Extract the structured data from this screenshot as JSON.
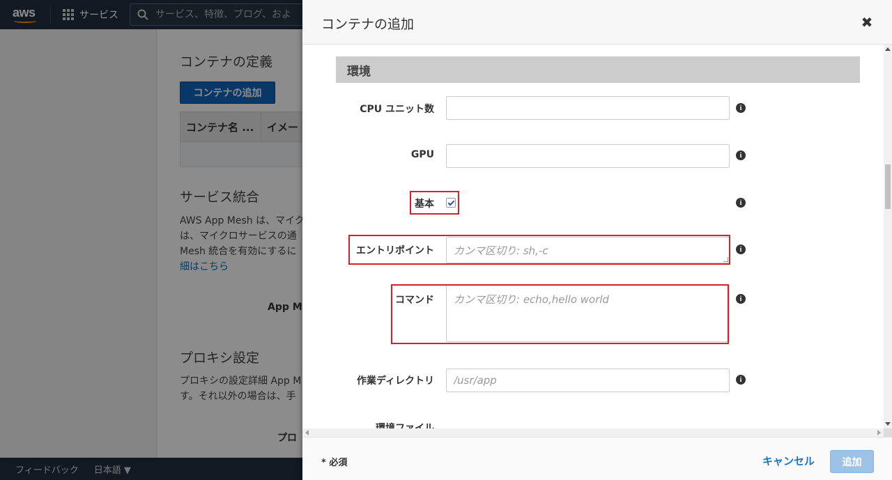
{
  "topnav": {
    "logo_text": "aws",
    "services_label": "サービス",
    "search_placeholder": "サービス、特徴、ブログ、およ"
  },
  "background": {
    "container_def_heading": "コンテナの定義",
    "add_container_button": "コンテナの追加",
    "table_headers": [
      "コンテナ名 ...",
      "イメー"
    ],
    "service_integration_heading": "サービス統合",
    "service_integration_lines": [
      "AWS App Mesh は、マイク",
      "は、マイクロサービスの通",
      "Mesh 統合を有効にするに"
    ],
    "service_integration_link": "細はこちら",
    "app_mesh_label": "App Me",
    "proxy_heading": "プロキシ設定",
    "proxy_lines": [
      "プロキシの設定詳細 App M",
      "す。それ以外の場合は、手"
    ],
    "proxy_bold": "プロ"
  },
  "footer": {
    "feedback": "フィードバック",
    "language": "日本語 ▼"
  },
  "modal": {
    "title": "コンテナの追加",
    "close_glyph": "✖",
    "section_heading": "環境",
    "fields": {
      "cpu_label": "CPU ユニット数",
      "cpu_value": "",
      "gpu_label": "GPU",
      "gpu_value": "",
      "essential_label": "基本",
      "essential_checked": true,
      "entrypoint_label": "エントリポイント",
      "entrypoint_placeholder": "カンマ区切り: sh,-c",
      "command_label": "コマンド",
      "command_placeholder": "カンマ区切り: echo,hello world",
      "workdir_label": "作業ディレクトリ",
      "workdir_placeholder": "/usr/app",
      "envfile_label": "環境ファイル"
    },
    "info_glyph": "i",
    "required_note": "* 必須",
    "cancel_label": "キャンセル",
    "add_label": "追加"
  },
  "colors": {
    "nav_bg": "#232f3e",
    "primary_button": "#1166bb",
    "highlight_red": "#d9202a",
    "disabled_button": "#9ec1e6",
    "link_blue": "#1a73c5"
  }
}
